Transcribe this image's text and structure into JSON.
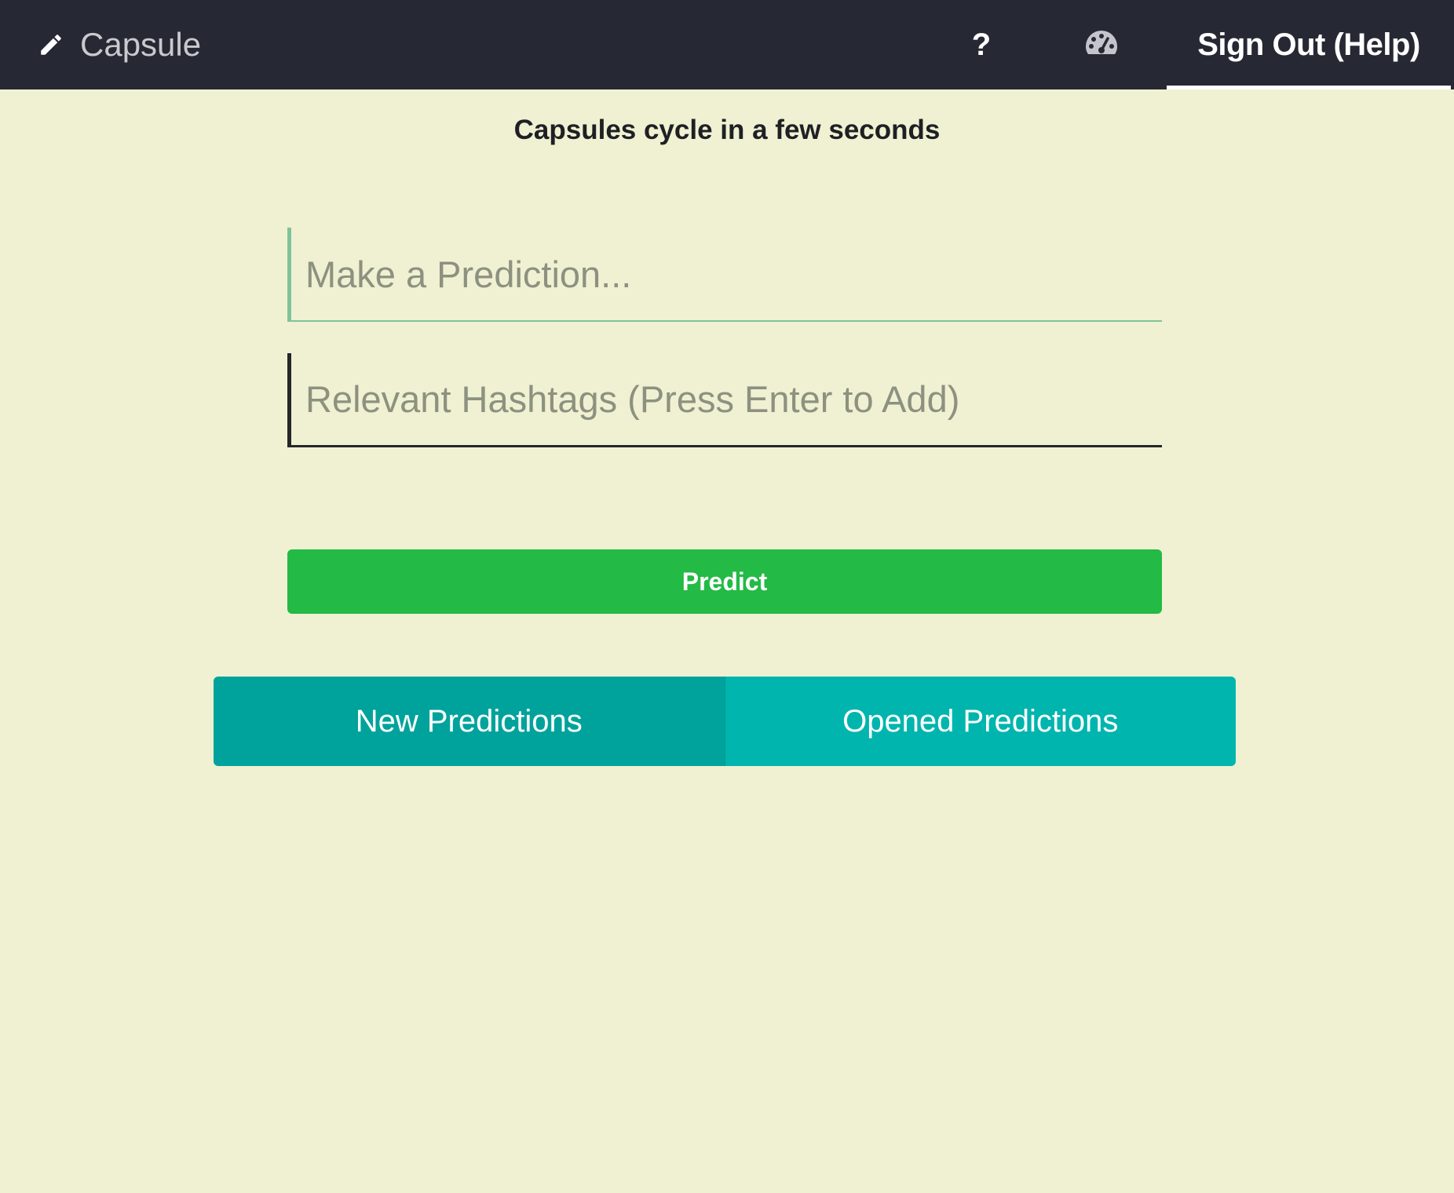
{
  "nav": {
    "brand": "Capsule",
    "help_label": "?",
    "dashboard_icon": "dashboard-icon",
    "signout_label": "Sign Out (Help)"
  },
  "main": {
    "heading": "Capsules cycle in a few seconds",
    "prediction_placeholder": "Make a Prediction...",
    "hashtags_placeholder": "Relevant Hashtags (Press Enter to Add)",
    "predict_label": "Predict",
    "tabs": [
      {
        "label": "New Predictions",
        "active": true
      },
      {
        "label": "Opened Predictions",
        "active": false
      }
    ]
  },
  "colors": {
    "nav_bg": "#262833",
    "page_bg": "#eff1d2",
    "predict_green": "#23ba45",
    "tab_active": "#00a39c",
    "tab_inactive": "#00b5ae",
    "prediction_accent": "#80c29b"
  }
}
